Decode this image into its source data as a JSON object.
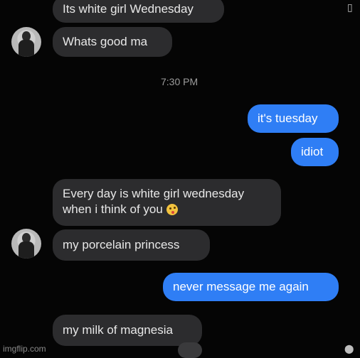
{
  "messages": {
    "m1": "Its white girl Wednesday",
    "m2": "Whats good ma",
    "time": "7:30 PM",
    "m3": "it's tuesday",
    "m4": "idiot",
    "m5_line1": "Every day is white girl wednesday",
    "m5_line2": "when i think of you",
    "m6": "my porcelain princess",
    "m7": "never message me again",
    "m8": "my milk of magnesia"
  },
  "icons": {
    "emoji": "kissing-face-emoji",
    "avatar": "profile-avatar",
    "corner": "share-icon",
    "reaction": "reaction-icon"
  },
  "watermark": "imgflip.com",
  "colors": {
    "background": "#050505",
    "received_bubble": "#2c2c2e",
    "sent_bubble": "#2f7ef5",
    "received_text": "#e8e8e8",
    "sent_text": "#ffffff",
    "timestamp": "#9c9c9c"
  }
}
